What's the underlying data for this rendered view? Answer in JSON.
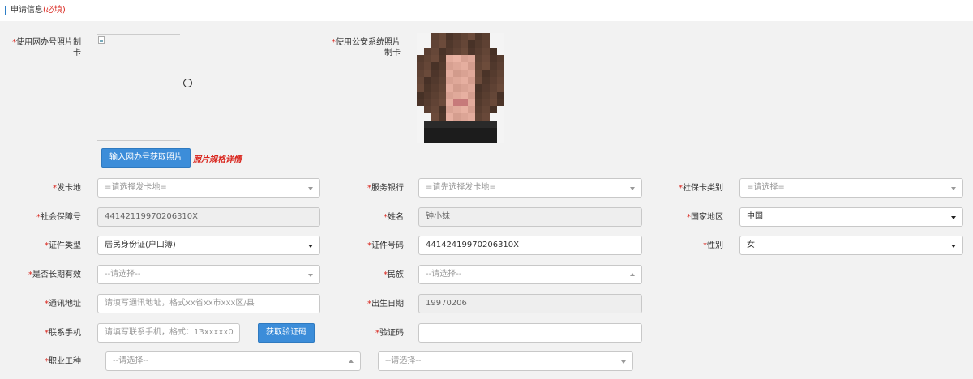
{
  "header": {
    "title": "申请信息",
    "required_note": "(必填)"
  },
  "photos": {
    "id_photo_label": "使用网办号照片制卡",
    "police_photo_label": "使用公安系统照片制卡",
    "fetch_button": "输入网办号获取照片",
    "spec_link": "照片规格详情"
  },
  "form": {
    "issue_place": {
      "label": "发卡地",
      "value": "=请选择发卡地="
    },
    "bank": {
      "label": "服务银行",
      "value": "=请先选择发卡地="
    },
    "card_type": {
      "label": "社保卡类别",
      "value": "=请选择="
    },
    "ss_number": {
      "label": "社会保障号",
      "value": "44142119970206310X"
    },
    "name": {
      "label": "姓名",
      "value": "钟小妹"
    },
    "country": {
      "label": "国家地区",
      "value": "中国"
    },
    "id_type": {
      "label": "证件类型",
      "value": "居民身份证(户口簿)"
    },
    "id_number": {
      "label": "证件号码",
      "value": "44142419970206310X"
    },
    "gender": {
      "label": "性别",
      "value": "女"
    },
    "long_term": {
      "label": "是否长期有效",
      "value": "--请选择--"
    },
    "ethnicity": {
      "label": "民族",
      "value": "--请选择--"
    },
    "address": {
      "label": "通讯地址",
      "value": "请填写通讯地址，格式xx省xx市xxx区/县"
    },
    "birth_date": {
      "label": "出生日期",
      "value": "19970206"
    },
    "phone": {
      "label": "联系手机",
      "value": "请填写联系手机，格式：13xxxxx0"
    },
    "code_button": "获取验证码",
    "verify_code": {
      "label": "验证码",
      "value": ""
    },
    "occupation": {
      "label": "职业工种",
      "value1": "--请选择--",
      "value2": "--请选择--"
    }
  },
  "colors": {
    "accent": "#3c8dd9",
    "required": "#d9251d"
  }
}
